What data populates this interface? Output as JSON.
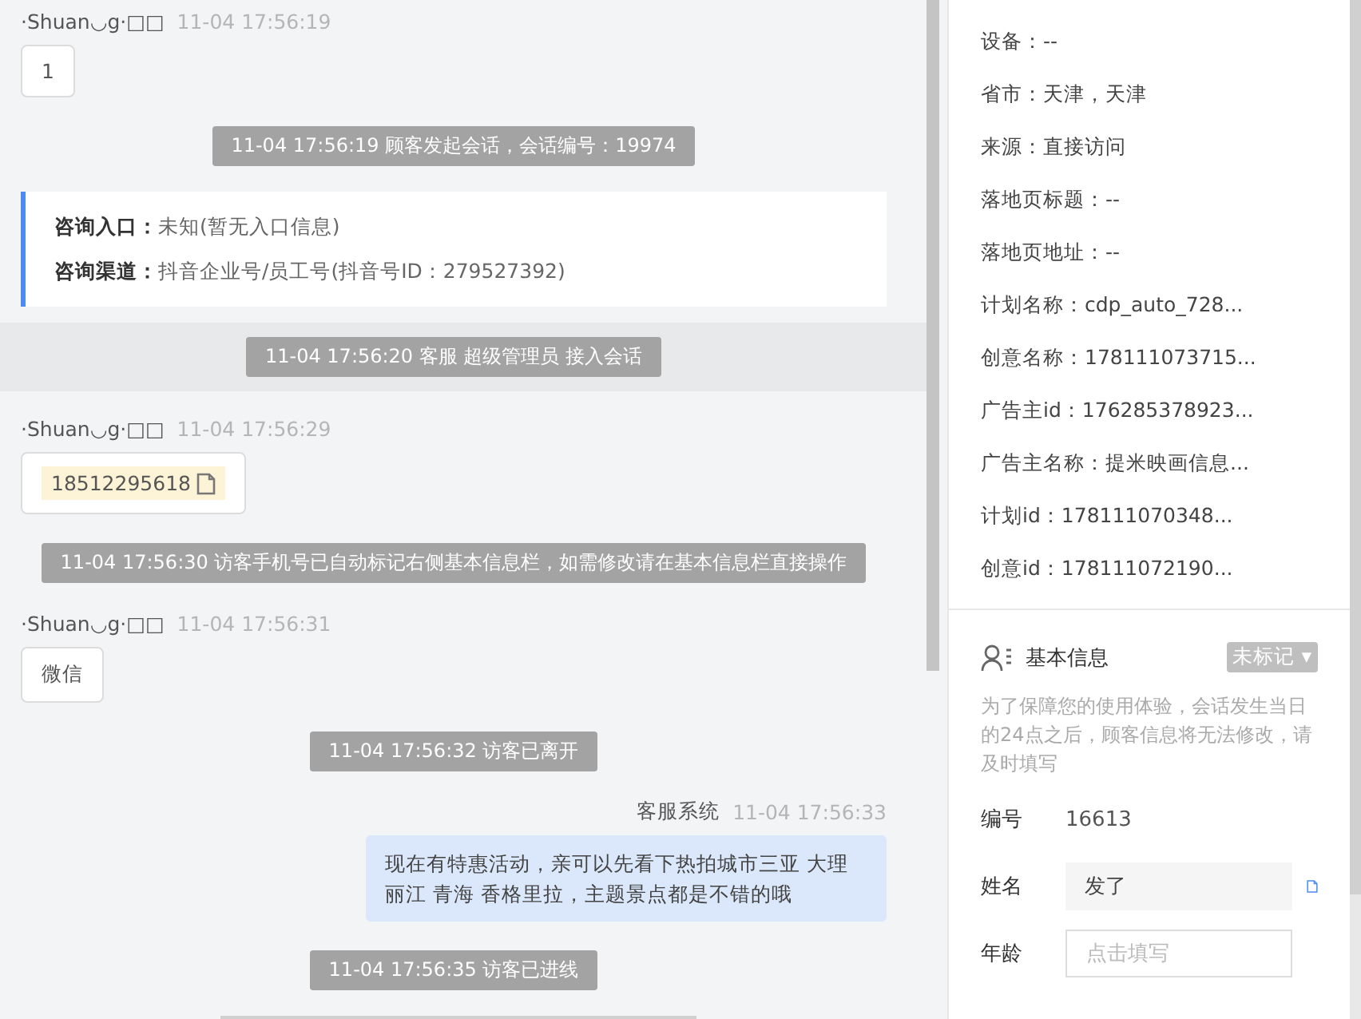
{
  "chat": {
    "messages": [
      {
        "kind": "visitor",
        "sender": "·Shuan◡g·□□",
        "time": "11-04 17:56:19",
        "text": "1"
      },
      {
        "kind": "system",
        "text": "11-04 17:56:19 顾客发起会话，会话编号：19974"
      },
      {
        "kind": "entry_card",
        "rows": [
          {
            "label": "咨询入口：",
            "value": "未知(暂无入口信息)"
          },
          {
            "label": "咨询渠道：",
            "value": "抖音企业号/员工号(抖音号ID：279527392)"
          }
        ]
      },
      {
        "kind": "system_band",
        "text": "11-04 17:56:20 客服 超级管理员 接入会话"
      },
      {
        "kind": "phone",
        "sender": "·Shuan◡g·□□",
        "time": "11-04 17:56:29",
        "text": "18512295618"
      },
      {
        "kind": "system",
        "text": "11-04 17:56:30 访客手机号已自动标记右侧基本信息栏，如需修改请在基本信息栏直接操作"
      },
      {
        "kind": "visitor",
        "sender": "·Shuan◡g·□□",
        "time": "11-04 17:56:31",
        "text": "微信"
      },
      {
        "kind": "system",
        "text": "11-04 17:56:32 访客已离开"
      },
      {
        "kind": "agent",
        "sender": "客服系统",
        "time": "11-04 17:56:33",
        "text": "现在有特惠活动，亲可以先看下热拍城市三亚 大理丽江 青海 香格里拉，主题景点都是不错的哦"
      },
      {
        "kind": "system",
        "text": "11-04 17:56:35 访客已进线"
      },
      {
        "kind": "system_cut"
      }
    ]
  },
  "visitor_info": {
    "fields": [
      "设备：--",
      "省市：天津，天津",
      "来源：直接访问",
      "落地页标题：--",
      "落地页地址：--",
      "计划名称：cdp_auto_728...",
      "创意名称：178111073715...",
      "广告主id：176285378923...",
      "广告主名称：提米映画信息...",
      "计划id：178111070348...",
      "创意id：178111072190..."
    ]
  },
  "basic_info": {
    "title": "基本信息",
    "tag": "未标记",
    "tag_caret": "▾",
    "notice": "为了保障您的使用体验，会话发生当日的24点之后，顾客信息将无法修改，请及时填写",
    "fields": [
      {
        "kind": "text",
        "label": "编号",
        "value": "16613"
      },
      {
        "kind": "copyable_input",
        "label": "姓名",
        "value": "发了"
      },
      {
        "kind": "input",
        "label": "年龄",
        "placeholder": "点击填写"
      }
    ]
  }
}
